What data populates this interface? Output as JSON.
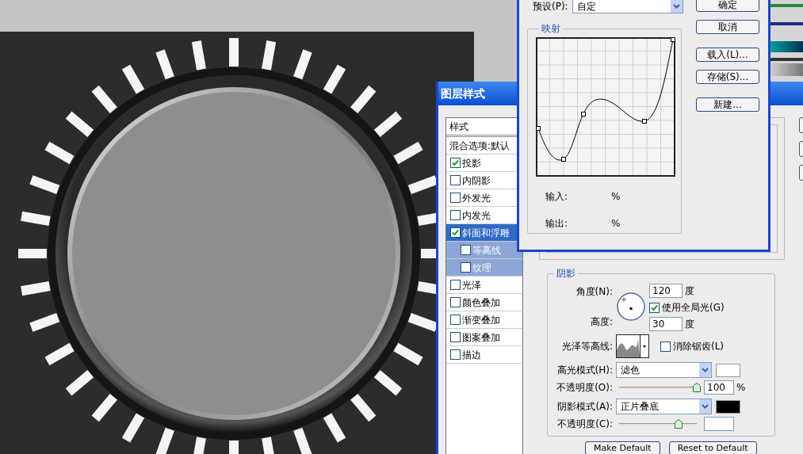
{
  "layer_style": {
    "title": "图层样式",
    "styles_header": "样式",
    "blending": "混合选项:默认",
    "items": [
      {
        "label": "投影",
        "checked": true,
        "selected": false
      },
      {
        "label": "内阴影",
        "checked": false,
        "selected": false
      },
      {
        "label": "外发光",
        "checked": false,
        "selected": false
      },
      {
        "label": "内发光",
        "checked": false,
        "selected": false
      },
      {
        "label": "斜面和浮雕",
        "checked": true,
        "selected": true,
        "children": [
          {
            "label": "等高线",
            "checked": false,
            "selected": false
          },
          {
            "label": "纹理",
            "checked": false,
            "selected": false
          }
        ]
      },
      {
        "label": "光泽",
        "checked": false,
        "selected": false
      },
      {
        "label": "颜色叠加",
        "checked": false,
        "selected": false
      },
      {
        "label": "渐变叠加",
        "checked": false,
        "selected": false
      },
      {
        "label": "图案叠加",
        "checked": false,
        "selected": false
      },
      {
        "label": "描边",
        "checked": false,
        "selected": false
      }
    ],
    "shading": {
      "title": "阴影",
      "angle_label": "角度(N):",
      "angle_value": "120",
      "angle_unit": "度",
      "global_light": {
        "label": "使用全局光(G)",
        "checked": true
      },
      "altitude_label": "高度:",
      "altitude_value": "30",
      "altitude_unit": "度",
      "gloss_label": "光泽等高线:",
      "anti_alias": {
        "label": "消除锯齿(L)",
        "checked": false
      },
      "modes": [
        {
          "label": "高光模式(H):",
          "value": "滤色",
          "color": "#ffffff",
          "opacity_label": "不透明度(O):",
          "level": 1.0,
          "opacity_value": "100",
          "opacity_unit": "%"
        },
        {
          "label": "阴影模式(A):",
          "value": "正片叠底",
          "color": "#000000",
          "opacity_label": "不透明度(C):",
          "level": 0.77
        }
      ]
    },
    "buttons": [
      "Make Default",
      "Reset to Default"
    ]
  },
  "contour_editor": {
    "preset_label": "预设(P):",
    "preset_value": "自定",
    "section": "映射",
    "input_label": "输入:",
    "input_unit": "%",
    "output_label": "输出:",
    "output_unit": "%",
    "buttons": [
      "确定",
      "取消",
      "载入(L)...",
      "存储(S)...",
      "新建..."
    ]
  }
}
